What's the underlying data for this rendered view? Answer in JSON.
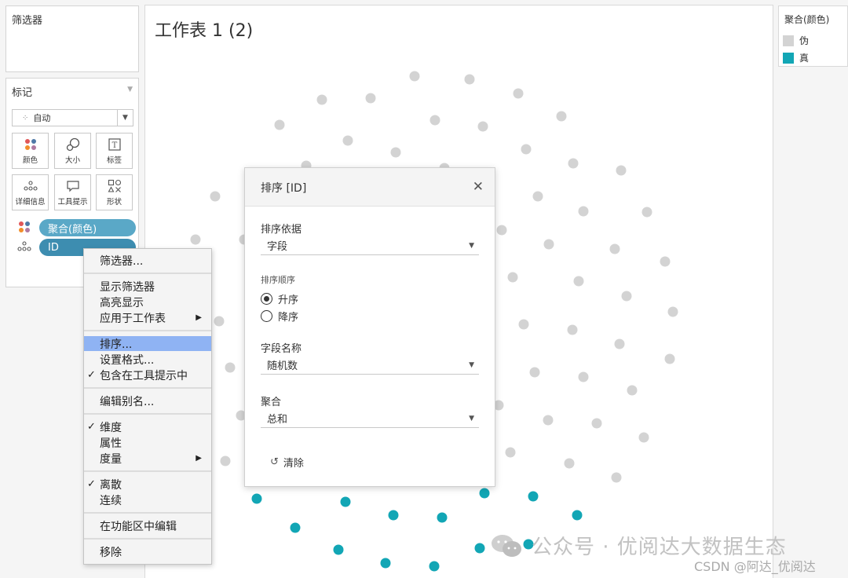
{
  "filters_panel": {
    "title": "筛选器"
  },
  "marks_panel": {
    "title": "标记",
    "mark_type": "自动",
    "cards": [
      {
        "label": "颜色",
        "icon": "color-dots-icon"
      },
      {
        "label": "大小",
        "icon": "size-icon"
      },
      {
        "label": "标签",
        "icon": "text-label-icon"
      },
      {
        "label": "详细信息",
        "icon": "detail-dots-icon"
      },
      {
        "label": "工具提示",
        "icon": "tooltip-icon"
      },
      {
        "label": "形状",
        "icon": "shape-icon"
      }
    ],
    "pills": [
      {
        "label": "聚合(颜色)",
        "color": "#5aa8c7"
      },
      {
        "label": "ID",
        "color": "#3d8db0"
      }
    ]
  },
  "worksheet": {
    "title": "工作表 1 (2)"
  },
  "legend": {
    "title": "聚合(颜色)",
    "items": [
      {
        "label": "伪",
        "color": "#d3d3d3"
      },
      {
        "label": "真",
        "color": "#12a6b5"
      }
    ]
  },
  "sort_dialog": {
    "title": "排序 [ID]",
    "sort_by_label": "排序依据",
    "sort_by_value": "字段",
    "order_label": "排序顺序",
    "order_options": [
      {
        "label": "升序",
        "checked": true
      },
      {
        "label": "降序",
        "checked": false
      }
    ],
    "field_name_label": "字段名称",
    "field_name_value": "随机数",
    "aggregation_label": "聚合",
    "aggregation_value": "总和",
    "clear_label": "清除"
  },
  "context_menu": {
    "items": [
      {
        "label": "筛选器...",
        "check": false,
        "arrow": false,
        "highlight": false
      },
      {
        "label": "显示筛选器",
        "check": false,
        "arrow": false,
        "highlight": false
      },
      {
        "label": "高亮显示",
        "check": false,
        "arrow": false,
        "highlight": false
      },
      {
        "label": "应用于工作表",
        "check": false,
        "arrow": true,
        "highlight": false
      },
      {
        "label": "排序...",
        "check": false,
        "arrow": false,
        "highlight": true
      },
      {
        "label": "设置格式...",
        "check": false,
        "arrow": false,
        "highlight": false
      },
      {
        "label": "包含在工具提示中",
        "check": true,
        "arrow": false,
        "highlight": false
      },
      {
        "label": "编辑别名...",
        "check": false,
        "arrow": false,
        "highlight": false
      },
      {
        "label": "维度",
        "check": true,
        "arrow": false,
        "highlight": false
      },
      {
        "label": "属性",
        "check": false,
        "arrow": false,
        "highlight": false
      },
      {
        "label": "度量",
        "check": false,
        "arrow": true,
        "highlight": false
      },
      {
        "label": "离散",
        "check": true,
        "arrow": false,
        "highlight": false
      },
      {
        "label": "连续",
        "check": false,
        "arrow": false,
        "highlight": false
      },
      {
        "label": "在功能区中编辑",
        "check": false,
        "arrow": false,
        "highlight": false
      },
      {
        "label": "移除",
        "check": false,
        "arrow": false,
        "highlight": false
      }
    ],
    "check_glyph": "✓",
    "arrow_glyph": "▶"
  },
  "watermark": {
    "text": "公众号 · 优阅达大数据生态",
    "credit": "CSDN @阿达_优阅达"
  }
}
